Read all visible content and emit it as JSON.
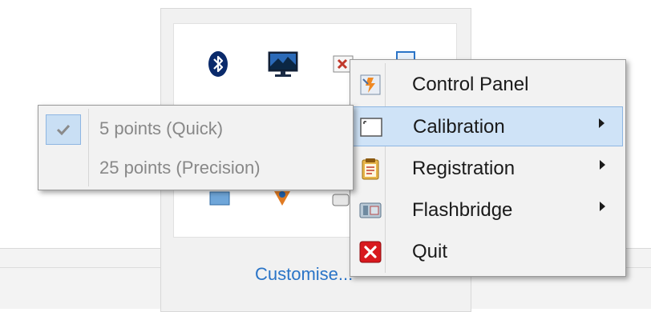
{
  "tray": {
    "customise_label": "Customise..."
  },
  "context_menu": {
    "items": [
      {
        "label": "Control Panel",
        "icon": "control-panel-icon",
        "has_submenu": false
      },
      {
        "label": "Calibration",
        "icon": "calibration-icon",
        "has_submenu": true
      },
      {
        "label": "Registration",
        "icon": "registration-icon",
        "has_submenu": true
      },
      {
        "label": "Flashbridge",
        "icon": "flashbridge-icon",
        "has_submenu": true
      },
      {
        "label": "Quit",
        "icon": "quit-icon",
        "has_submenu": false
      }
    ],
    "highlighted": "Calibration"
  },
  "calibration_submenu": {
    "items": [
      {
        "label": "5 points (Quick)",
        "checked": true
      },
      {
        "label": "25 points (Precision)",
        "checked": false
      }
    ]
  },
  "colors": {
    "highlight": "#cfe3f7",
    "highlight_border": "#8eb6e2",
    "link": "#2a74c7",
    "disabled_text": "#888888"
  }
}
